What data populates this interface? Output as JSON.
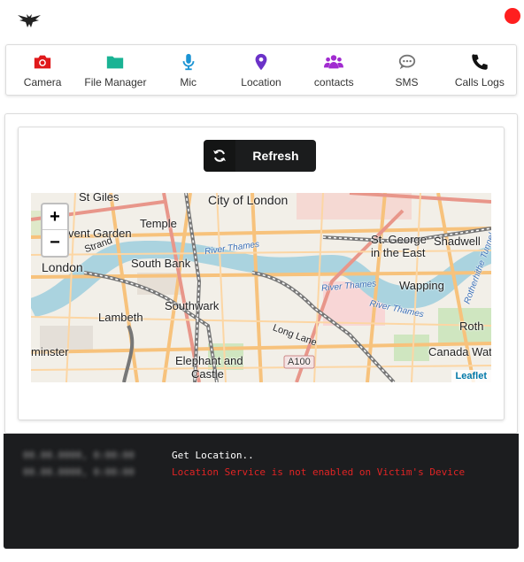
{
  "toolbar": {
    "items": [
      {
        "label": "Camera",
        "icon": "camera-icon",
        "color": "#e0191b"
      },
      {
        "label": "File Manager",
        "icon": "folder-icon",
        "color": "#1ab394"
      },
      {
        "label": "Mic",
        "icon": "mic-icon",
        "color": "#1b94d4"
      },
      {
        "label": "Location",
        "icon": "map-pin-icon",
        "color": "#6b32c8"
      },
      {
        "label": "contacts",
        "icon": "users-icon",
        "color": "#a12bd0"
      },
      {
        "label": "SMS",
        "icon": "chat-icon",
        "color": "#767676"
      },
      {
        "label": "Calls Logs",
        "icon": "phone-icon",
        "color": "#111111"
      }
    ]
  },
  "status_color": "#ff1f1f",
  "refresh": {
    "label": "Refresh"
  },
  "map": {
    "zoom_in": "+",
    "zoom_out": "−",
    "attribution": "Leaflet",
    "labels": {
      "st_giles": "St Giles",
      "city": "City of London",
      "covent": "vent Garden",
      "temple": "Temple",
      "strand": "Strand",
      "st_george": "St. George",
      "in_the_east": "in the East",
      "shadwell": "Shadwell",
      "london": "London",
      "south_bank": "South Bank",
      "wapping": "Wapping",
      "lambeth": "Lambeth",
      "southwark": "Southwark",
      "long_lane": "Long Lane",
      "minster": "minster",
      "elephant": "Elephant and",
      "castle": "Castle",
      "a100": "A100",
      "canada": "Canada Wate",
      "roth": "Roth",
      "river1": "River Thames",
      "river2": "River Thames",
      "river3": "River Thames",
      "rotherhithe": "Rotherhithe Tunnel"
    }
  },
  "console": {
    "timestamps": [
      "00.00.0000, 0:00:00",
      "00.00.0000, 0:00:00"
    ],
    "line1": "Get Location..",
    "line2": "Location Service is not enabled on Victim's Device"
  }
}
